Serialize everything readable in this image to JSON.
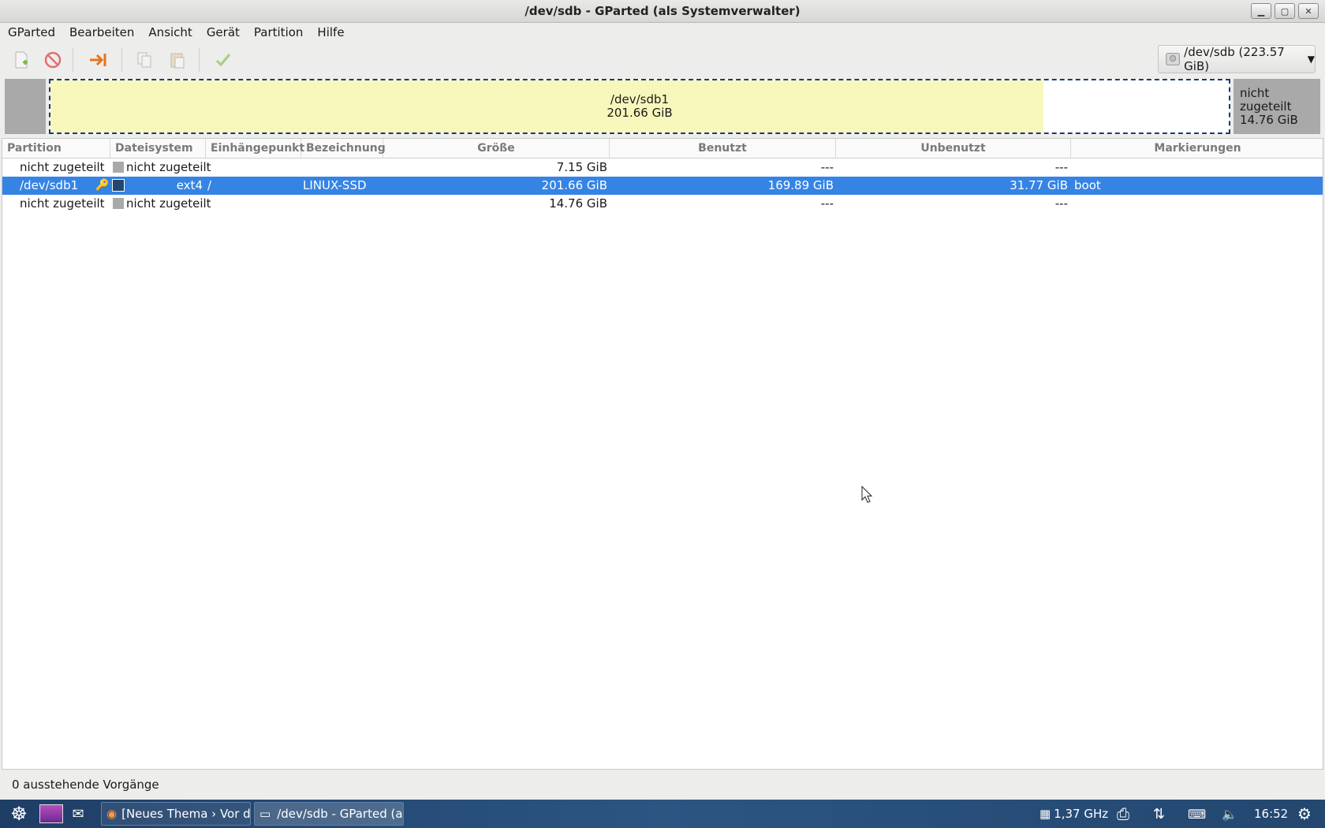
{
  "window": {
    "title": "/dev/sdb - GParted (als Systemverwalter)"
  },
  "menu": [
    "GParted",
    "Bearbeiten",
    "Ansicht",
    "Gerät",
    "Partition",
    "Hilfe"
  ],
  "toolbar": {
    "icons": [
      "new-icon",
      "delete-icon",
      "resize-move-icon",
      "copy-icon",
      "paste-icon",
      "apply-icon"
    ]
  },
  "device_selector": {
    "label": "/dev/sdb (223.57 GiB)"
  },
  "disk_map": {
    "main_name": "/dev/sdb1",
    "main_size": "201.66 GiB",
    "main_used_fraction": 0.843,
    "unalloc_label": "nicht zugeteilt",
    "unalloc_size": "14.76 GiB"
  },
  "table": {
    "headers": [
      "Partition",
      "Dateisystem",
      "Einhängepunkt",
      "Bezeichnung",
      "Größe",
      "Benutzt",
      "Unbenutzt",
      "Markierungen"
    ],
    "rows": [
      {
        "partition": "nicht zugeteilt",
        "filesystem": "nicht zugeteilt",
        "mount": "",
        "label": "",
        "size": "7.15 GiB",
        "used": "---",
        "unused": "---",
        "flags": "",
        "fs_color": "#a9a9a9"
      },
      {
        "partition": "/dev/sdb1",
        "filesystem": "ext4",
        "mount": "/",
        "label": "LINUX-SSD",
        "size": "201.66 GiB",
        "used": "169.89 GiB",
        "unused": "31.77 GiB",
        "flags": "boot",
        "fs_color": "#24466f"
      },
      {
        "partition": "nicht zugeteilt",
        "filesystem": "nicht zugeteilt",
        "mount": "",
        "label": "",
        "size": "14.76 GiB",
        "used": "---",
        "unused": "---",
        "flags": "",
        "fs_color": "#a9a9a9"
      }
    ]
  },
  "status": {
    "text": "0 ausstehende Vorgänge"
  },
  "taskbar": {
    "tasks": [
      "[Neues Thema › Vor d...",
      "/dev/sdb - GParted (a..."
    ],
    "cpu": "1,37 GHz",
    "clock": "16:52"
  }
}
